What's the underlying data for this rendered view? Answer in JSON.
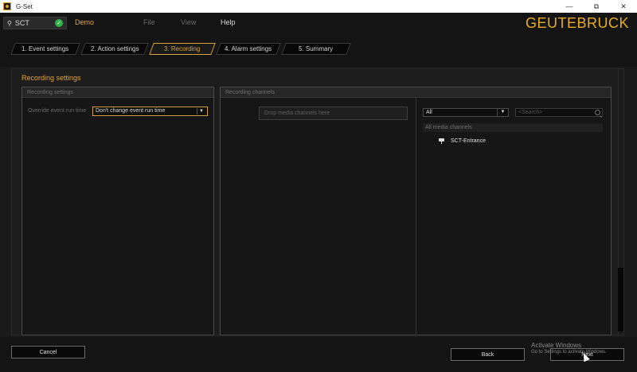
{
  "window": {
    "title": "G-Set",
    "minimize": "—",
    "maximize": "⧉",
    "close": "✕"
  },
  "menubar": {
    "project": "SCT",
    "mode": "Demo",
    "items": [
      "File",
      "View",
      "Help"
    ],
    "brand": "GEUTEBRUCK"
  },
  "tabs": [
    {
      "label": "1. Event settings",
      "active": false
    },
    {
      "label": "2. Action settings",
      "active": false
    },
    {
      "label": "3. Recording",
      "active": true
    },
    {
      "label": "4. Alarm settings",
      "active": false
    },
    {
      "label": "5. Summary",
      "active": false
    }
  ],
  "main": {
    "title": "Recording settings",
    "recording_settings": {
      "header": "Recording settings",
      "override_label": "Override event run time",
      "override_value": "Don't change event run time"
    },
    "recording_channels": {
      "header": "Recording channels",
      "drop_placeholder": "Drop media channels here",
      "filter_value": "All",
      "search_placeholder": "<Search>",
      "list_header": "All media channels",
      "channels": [
        "SCT-Entrance"
      ]
    }
  },
  "footer": {
    "cancel": "Cancel",
    "back": "Back",
    "next": "Next",
    "activate_line1": "Activate Windows",
    "activate_line2": "Go to Settings to activate Windows."
  },
  "colors": {
    "accent": "#e0a43a",
    "success": "#32b34a"
  }
}
